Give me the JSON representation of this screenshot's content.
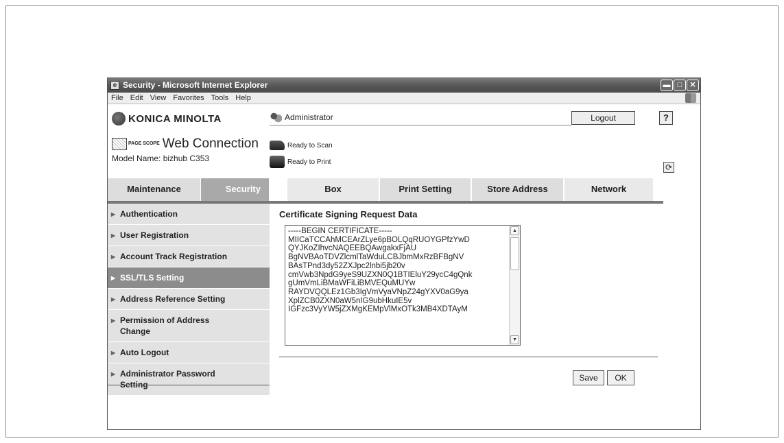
{
  "window": {
    "title": "Security - Microsoft Internet Explorer"
  },
  "menubar": {
    "items": [
      "File",
      "Edit",
      "View",
      "Favorites",
      "Tools",
      "Help"
    ]
  },
  "brand": {
    "company": "KONICA MINOLTA",
    "pagescope_small": "PAGE SCOPE",
    "product": "Web Connection",
    "model_label": "Model Name: bizhub C353"
  },
  "header": {
    "user": "Administrator",
    "logout_label": "Logout",
    "help_label": "?",
    "scan_status": "Ready to Scan",
    "print_status": "Ready to Print"
  },
  "tabs": [
    {
      "label": "Maintenance"
    },
    {
      "label": "Security"
    },
    {
      "label": "Box"
    },
    {
      "label": "Print Setting"
    },
    {
      "label": "Store Address"
    },
    {
      "label": "Network"
    }
  ],
  "sidebar": {
    "items": [
      {
        "label": "Authentication"
      },
      {
        "label": "User Registration"
      },
      {
        "label": "Account Track Registration"
      },
      {
        "label": "SSL/TLS Setting"
      },
      {
        "label": "Address Reference Setting"
      },
      {
        "label": "Permission of Address Change"
      },
      {
        "label": "Auto Logout"
      },
      {
        "label": "Administrator Password Setting"
      }
    ]
  },
  "content": {
    "title": "Certificate Signing Request Data",
    "csr_text": "-----BEGIN CERTIFICATE-----\nMIICaTCCAhMCEArZLye6pBOLQqRUOYGPfzYwD\nQYJKoZIhvcNAQEEBQAwgakxFjAU\nBgNVBAoTDVZlcmlTaWduLCBJbmMxRzBFBgNV\nBAsTPnd3dy52ZXJpc2lnbi5jb20v\ncmVwb3NpdG9yeS9UZXN0Q1BTIEluY29ycC4gQnk\ngUmVmLiBMaWFiLiBMVEQuMUYw\nRAYDVQQLEz1Gb3IgVmVyaVNpZ24gYXV0aG9ya\nXplZCB0ZXN0aW5nIG9ubHkuIE5v\nIGFzc3VyYW5jZXMgKEMpVlMxOTk3MB4XDTAyM",
    "save_label": "Save",
    "ok_label": "OK"
  }
}
